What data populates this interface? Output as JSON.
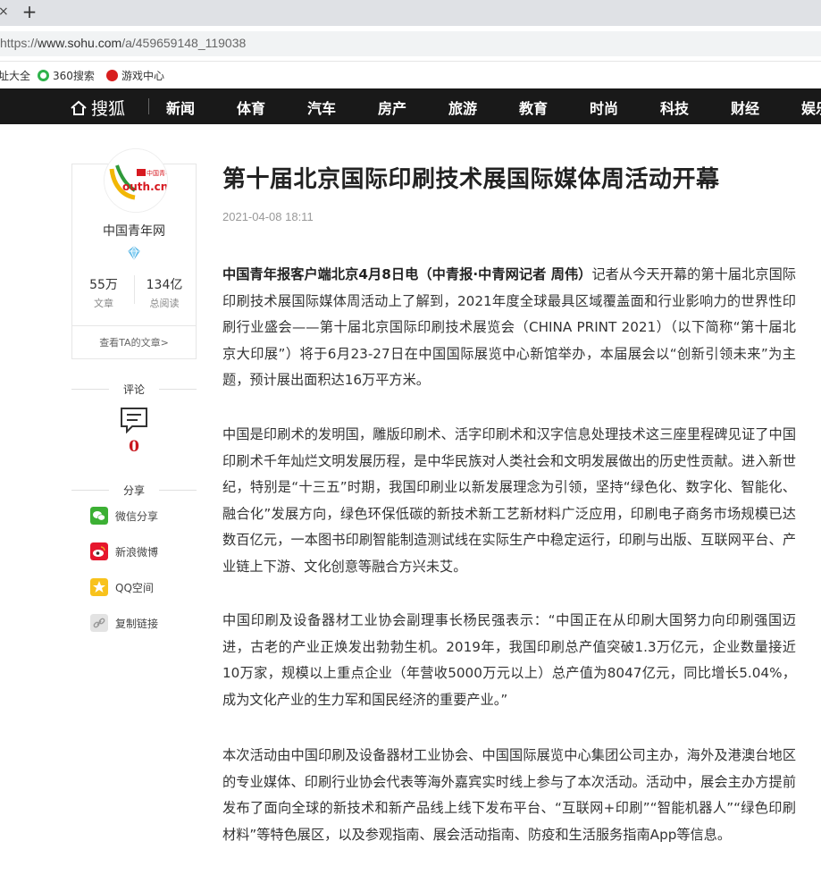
{
  "browser": {
    "tab_close": "×",
    "tab_new": "+",
    "url_prefix": "https://",
    "url_host": "www.sohu.com",
    "url_path": "/a/459659148_119038",
    "bookmarks": [
      "址大全",
      "360搜索",
      "游戏中心"
    ]
  },
  "nav": {
    "logo": "搜狐",
    "items": [
      "新闻",
      "体育",
      "汽车",
      "房产",
      "旅游",
      "教育",
      "时尚",
      "科技",
      "财经",
      "娱乐"
    ]
  },
  "author": {
    "logo_text_top": "中国青年网",
    "logo_text_main": "outh.cn",
    "name": "中国青年网",
    "articles_count": "55万",
    "articles_label": "文章",
    "reads_count": "134亿",
    "reads_label": "总阅读",
    "view_link": "查看TA的文章>"
  },
  "comments": {
    "heading": "评论",
    "count": "0"
  },
  "share": {
    "heading": "分享",
    "items": [
      "微信分享",
      "新浪微博",
      "QQ空间",
      "复制链接"
    ]
  },
  "article": {
    "title": "第十届北京国际印刷技术展国际媒体周活动开幕",
    "time": "2021-04-08 18:11",
    "lead_bold": "中国青年报客户端北京4月8日电（中青报·中青网记者 周伟）",
    "paragraphs": [
      "记者从今天开幕的第十届北京国际印刷技术展国际媒体周活动上了解到，2021年度全球最具区域覆盖面和行业影响力的世界性印刷行业盛会——第十届北京国际印刷技术展览会（CHINA PRINT 2021）（以下简称“第十届北京大印展”）将于6月23-27日在中国国际展览中心新馆举办，本届展会以“创新引领未来”为主题，预计展出面积达16万平方米。",
      "中国是印刷术的发明国，雕版印刷术、活字印刷术和汉字信息处理技术这三座里程碑见证了中国印刷术千年灿烂文明发展历程，是中华民族对人类社会和文明发展做出的历史性贡献。进入新世纪，特别是“十三五”时期，我国印刷业以新发展理念为引领，坚持“绿色化、数字化、智能化、融合化”发展方向，绿色环保低碳的新技术新工艺新材料广泛应用，印刷电子商务市场规模已达数百亿元，一本图书印刷智能制造测试线在实际生产中稳定运行，印刷与出版、互联网平台、产业链上下游、文化创意等融合方兴未艾。",
      "中国印刷及设备器材工业协会副理事长杨民强表示：“中国正在从印刷大国努力向印刷强国迈进，古老的产业正焕发出勃勃生机。2019年，我国印刷总产值突破1.3万亿元，企业数量接近10万家，规模以上重点企业（年营收5000万元以上）总产值为8047亿元，同比增长5.04%，成为文化产业的生力军和国民经济的重要产业。”",
      "本次活动由中国印刷及设备器材工业协会、中国国际展览中心集团公司主办，海外及港澳台地区的专业媒体、印刷行业协会代表等海外嘉宾实时线上参与了本次活动。活动中，展会主办方提前发布了面向全球的新技术和新产品线上线下发布平台、“互联网+印刷”“智能机器人”“绿色印刷材料”等特色展区，以及参观指南、展会活动指南、防疫和生活服务指南App等信息。"
    ]
  },
  "colors": {
    "nav_bg": "#191919",
    "comment_count": "#c8161d",
    "wechat": "#3cb034",
    "weibo": "#e6162d",
    "qzone": "#f8c21c",
    "link": "#b9b9b9"
  }
}
